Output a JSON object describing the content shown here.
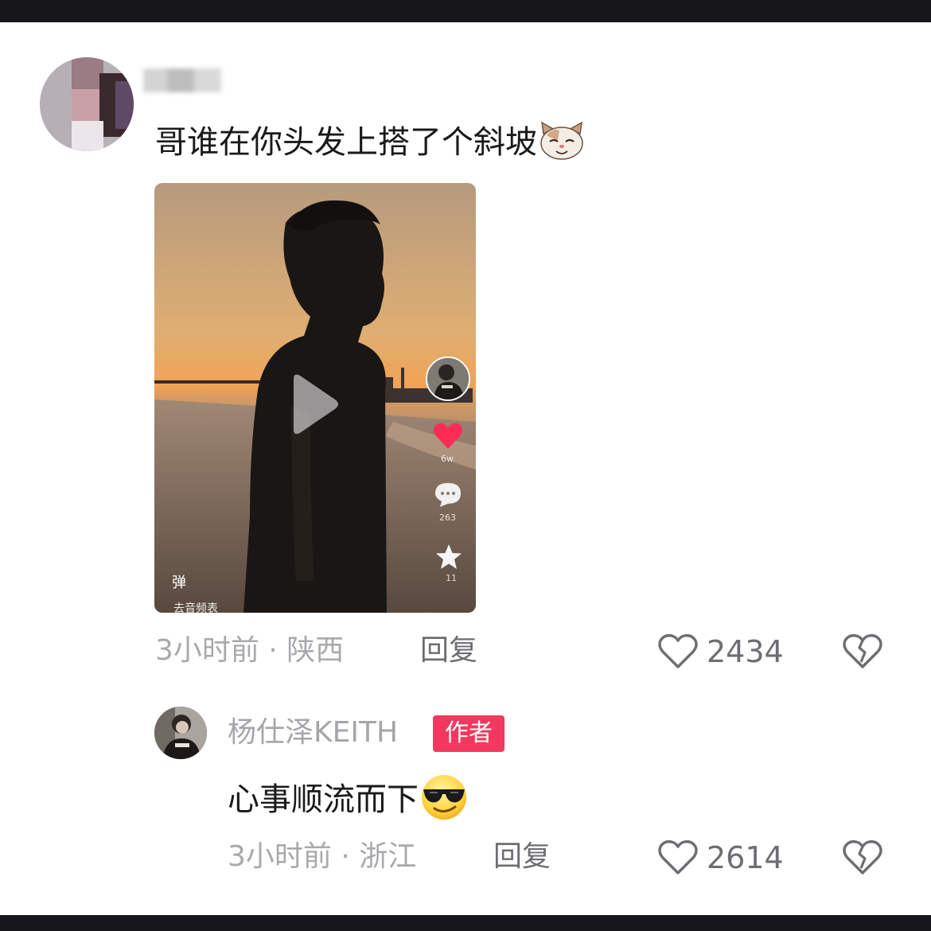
{
  "comment": {
    "text": "哥谁在你头发上搭了个斜坡",
    "time": "3小时前",
    "location": "陕西",
    "reply_label": "回复",
    "likes": "2434",
    "video": {
      "like_count": "6w",
      "comment_count": "263",
      "fav_count": "11",
      "danmu": "弹",
      "music": "去音频表"
    }
  },
  "reply": {
    "author": "杨仕泽KEITH",
    "badge": "作者",
    "text": "心事顺流而下",
    "time": "3小时前",
    "location": "浙江",
    "reply_label": "回复",
    "likes": "2614"
  },
  "colors": {
    "badge": "#f2385e",
    "heart_video": "#fe2c55",
    "meta": "#a9a9ad"
  }
}
